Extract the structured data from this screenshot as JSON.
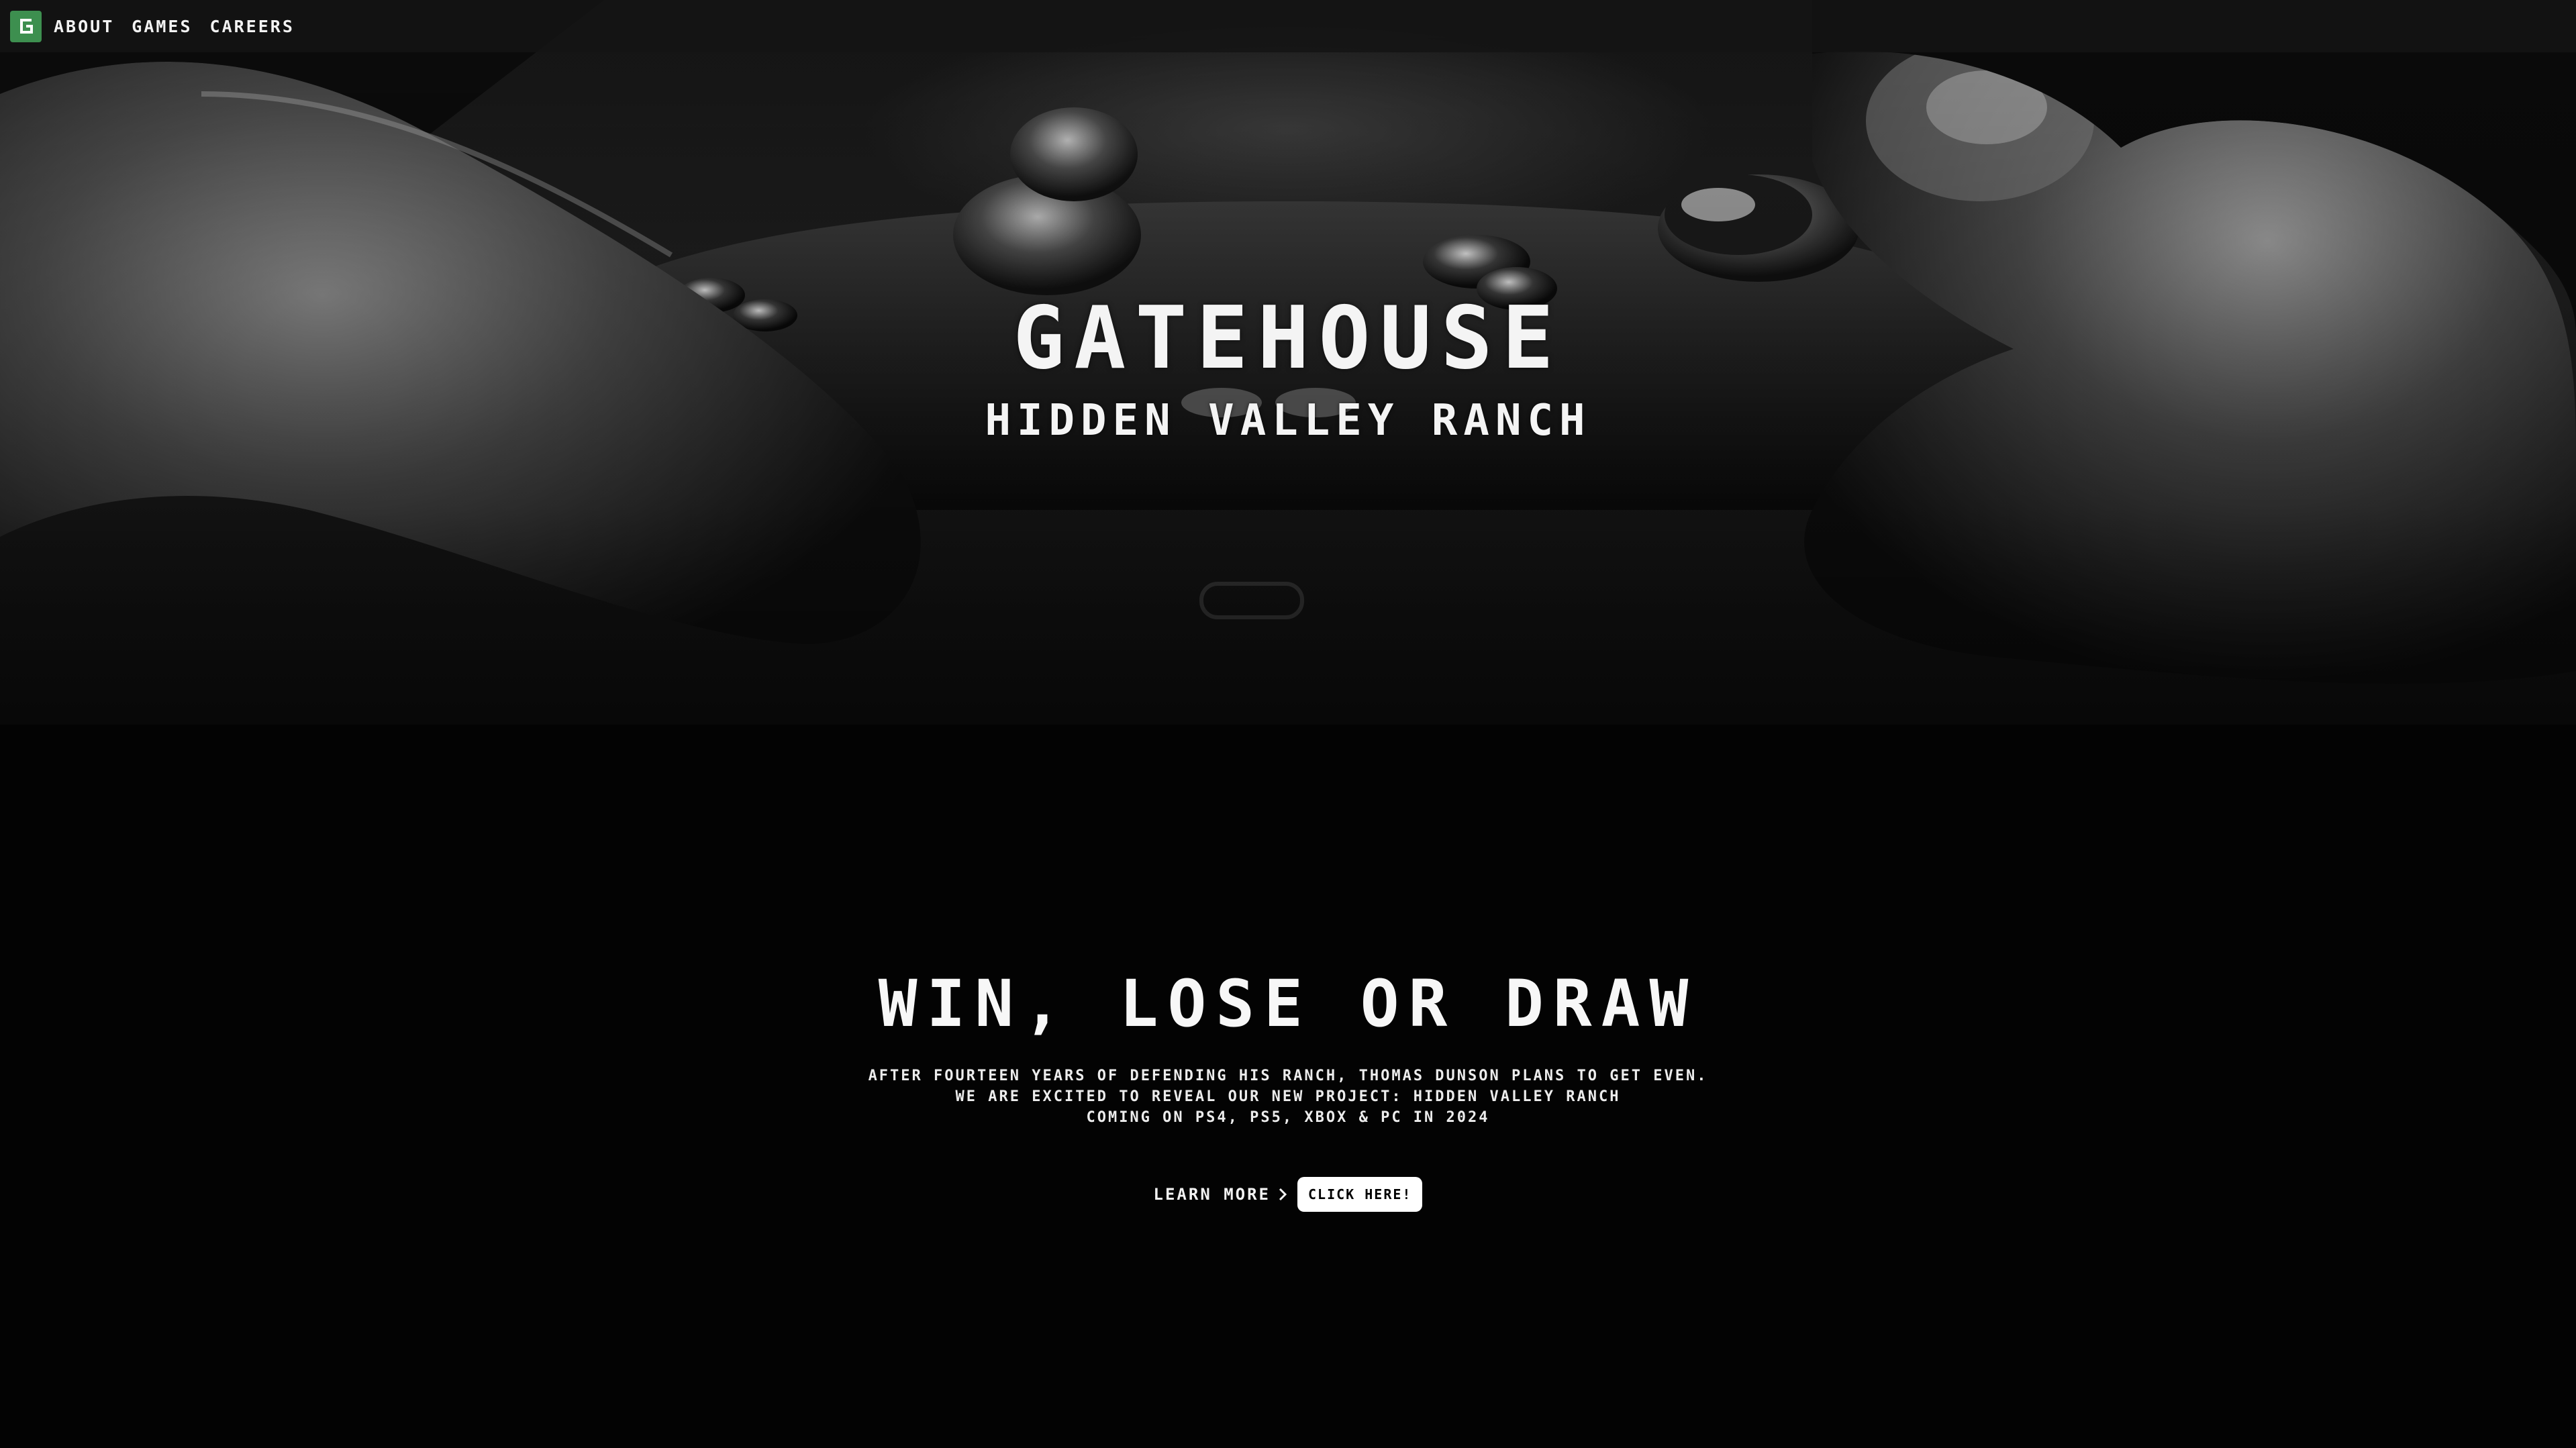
{
  "nav": {
    "logo_letter": "G",
    "items": [
      {
        "label": "ABOUT"
      },
      {
        "label": "GAMES"
      },
      {
        "label": "CAREERS"
      }
    ]
  },
  "hero": {
    "title": "GATEHOUSE",
    "subtitle": "HIDDEN VALLEY RANCH",
    "image": "hands-holding-game-controller-photo"
  },
  "promo": {
    "heading": "WIN, LOSE OR DRAW",
    "lines": [
      "AFTER FOURTEEN YEARS OF DEFENDING HIS RANCH, THOMAS DUNSON PLANS TO GET EVEN.",
      "WE ARE EXCITED TO REVEAL OUR NEW PROJECT: HIDDEN VALLEY RANCH",
      "COMING ON PS4, PS5, XBOX & PC IN 2024"
    ],
    "learn_more": "LEARN MORE",
    "click_here": "CLICK HERE!"
  },
  "colors": {
    "logo_bg": "#3d8f4f",
    "background": "#030303",
    "text": "#f4f4f4",
    "button_bg": "#ffffff"
  }
}
